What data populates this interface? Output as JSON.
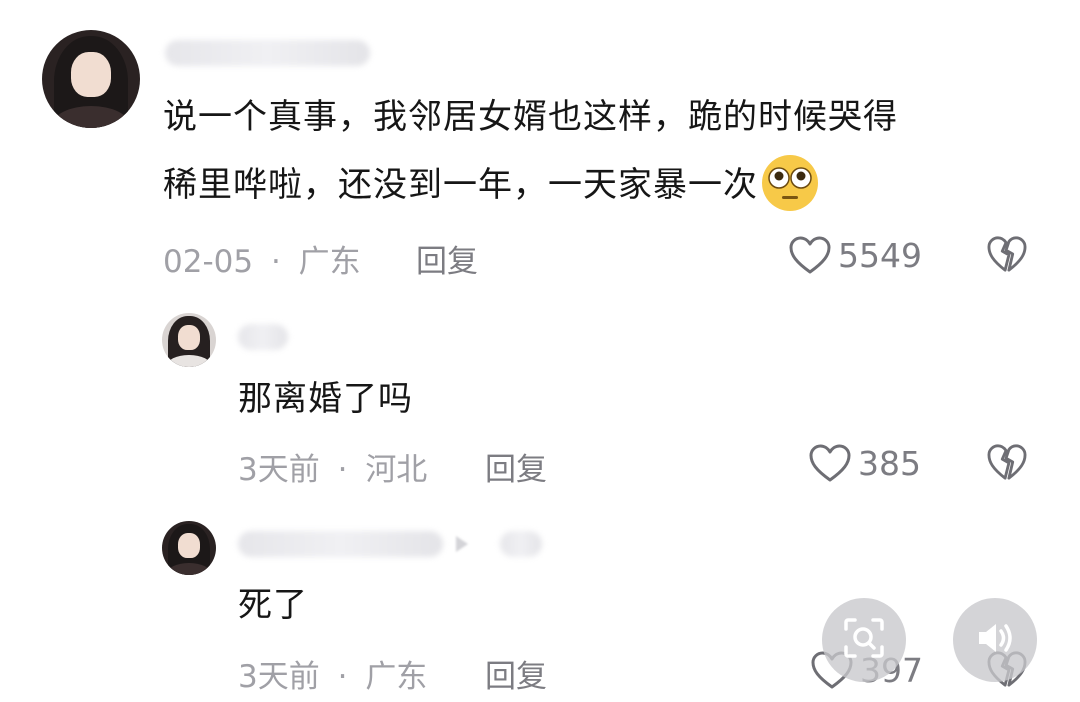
{
  "comments": [
    {
      "text_line1": "说一个真事，我邻居女婿也这样，跪的时候哭得",
      "text_line2": "稀里哗啦，还没到一年，一天家暴一次",
      "emoji": "flushed-face-emoji",
      "date": "02-05",
      "separator": "·",
      "location": "广东",
      "reply_label": "回复",
      "likes": "5549"
    },
    {
      "text": "那离婚了吗",
      "date": "3天前",
      "separator": "·",
      "location": "河北",
      "reply_label": "回复",
      "likes": "385"
    },
    {
      "text": "死了",
      "date": "3天前",
      "separator": "·",
      "location": "广东",
      "reply_label": "回复",
      "likes": "397"
    }
  ],
  "icons": {
    "like": "heart-icon",
    "dislike": "broken-heart-icon",
    "search": "image-search-icon",
    "volume": "volume-icon"
  },
  "colors": {
    "text": "#161616",
    "meta": "#a0a0a6",
    "icon": "#6e6e74",
    "fab": "#c8c8cc"
  }
}
